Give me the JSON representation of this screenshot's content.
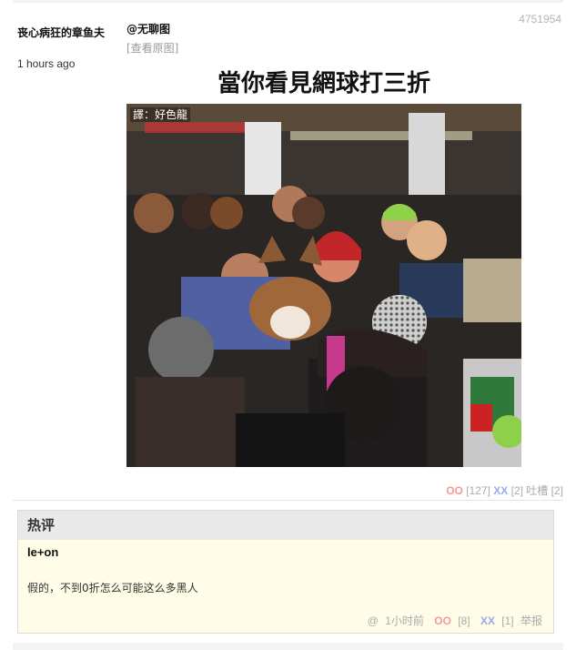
{
  "post": {
    "id": "4751954",
    "author": "丧心病狂的章鱼夫",
    "time": "1 hours ago",
    "mention": "@无聊图",
    "view_original": "[查看原图]"
  },
  "meme": {
    "caption": "當你看見網球打三折",
    "translator_tag": "譯：好色龍"
  },
  "votes": {
    "oo_label": "OO",
    "oo_count": "[127]",
    "xx_label": "XX",
    "xx_count": "[2]",
    "tucao_label": "吐槽",
    "tucao_count": "[2]"
  },
  "hot_comment": {
    "section_title": "热评",
    "author": "le+on",
    "text": "假的，不到0折怎么可能这么多黑人",
    "at": "@",
    "time": "1小时前",
    "oo_label": "OO",
    "oo_count": "[8]",
    "xx_label": "XX",
    "xx_count": "[1]",
    "report": "举报"
  },
  "colors": {
    "oo": "#f59a9a",
    "xx": "#9aa9f2",
    "comment_bg": "#fffde8",
    "header_bg": "#e9e9e9"
  }
}
